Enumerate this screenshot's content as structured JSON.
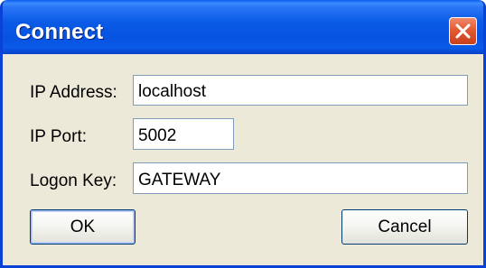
{
  "dialog": {
    "title": "Connect",
    "close_icon": "close-icon"
  },
  "form": {
    "ip_address": {
      "label": "IP Address:",
      "value": "localhost"
    },
    "ip_port": {
      "label": "IP Port:",
      "value": "5002"
    },
    "logon_key": {
      "label": "Logon Key:",
      "value": "GATEWAY"
    }
  },
  "buttons": {
    "ok_label": "OK",
    "cancel_label": "Cancel"
  }
}
